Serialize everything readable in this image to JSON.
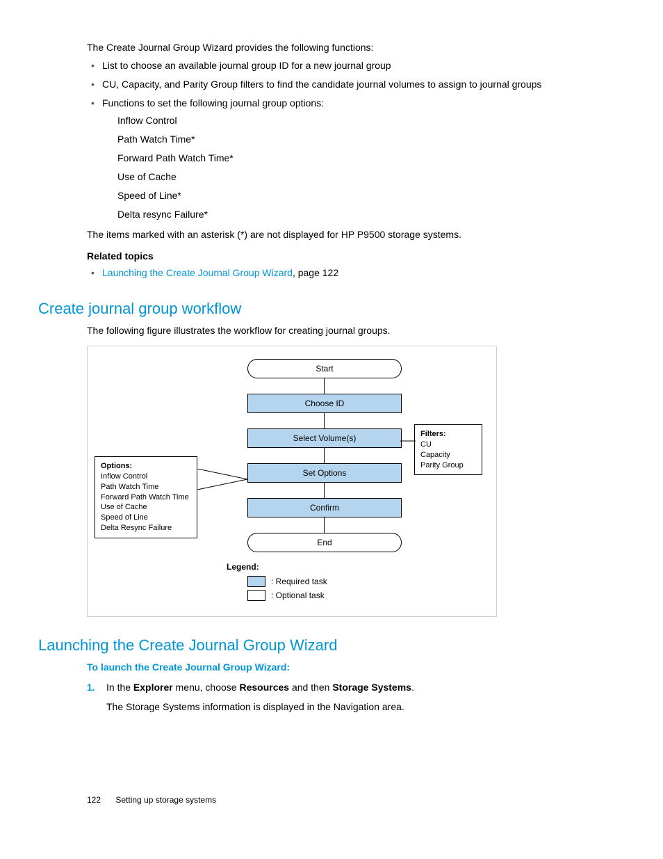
{
  "intro": "The Create Journal Group Wizard provides the following functions:",
  "bullets": {
    "b1": "List to choose an available journal group ID for a new journal group",
    "b2": "CU, Capacity, and Parity Group filters to find the candidate journal volumes to assign to journal groups",
    "b3": "Functions to set the following journal group options:"
  },
  "options_sub": {
    "o1": "Inflow Control",
    "o2": "Path Watch Time*",
    "o3": "Forward Path Watch Time*",
    "o4": "Use of Cache",
    "o5": "Speed of Line*",
    "o6": "Delta resync Failure*"
  },
  "note": "The items marked with an asterisk (*) are not displayed for HP P9500 storage systems.",
  "related": {
    "heading": "Related topics",
    "link_text": "Launching the Create Journal Group Wizard",
    "link_suffix": ", page 122"
  },
  "section_workflow": {
    "title": "Create journal group workflow",
    "desc": "The following figure illustrates the workflow for creating journal groups."
  },
  "diagram": {
    "start": "Start",
    "choose": "Choose ID",
    "select": "Select Volume(s)",
    "setopt": "Set Options",
    "confirm": "Confirm",
    "end": "End",
    "options_box": {
      "hdr": "Options:",
      "l1": "Inflow Control",
      "l2": "Path Watch Time",
      "l3": "Forward Path Watch Time",
      "l4": "Use of Cache",
      "l5": "Speed of Line",
      "l6": "Delta Resync Failure"
    },
    "filters_box": {
      "hdr": "Filters:",
      "l1": "CU",
      "l2": "Capacity",
      "l3": "Parity Group"
    },
    "legend": {
      "title": "Legend:",
      "req": ": Required task",
      "opt": ": Optional task"
    }
  },
  "section_launch": {
    "title": "Launching the Create Journal Group Wizard",
    "sub": "To launch the Create Journal Group Wizard:",
    "step1_pre": "In the ",
    "step1_b1": "Explorer",
    "step1_mid1": " menu, choose ",
    "step1_b2": "Resources",
    "step1_mid2": " and then ",
    "step1_b3": "Storage Systems",
    "step1_end": ".",
    "step1_num": "1.",
    "step1_sub": "The Storage Systems information is displayed in the Navigation area."
  },
  "footer": {
    "page": "122",
    "section": "Setting up storage systems"
  }
}
